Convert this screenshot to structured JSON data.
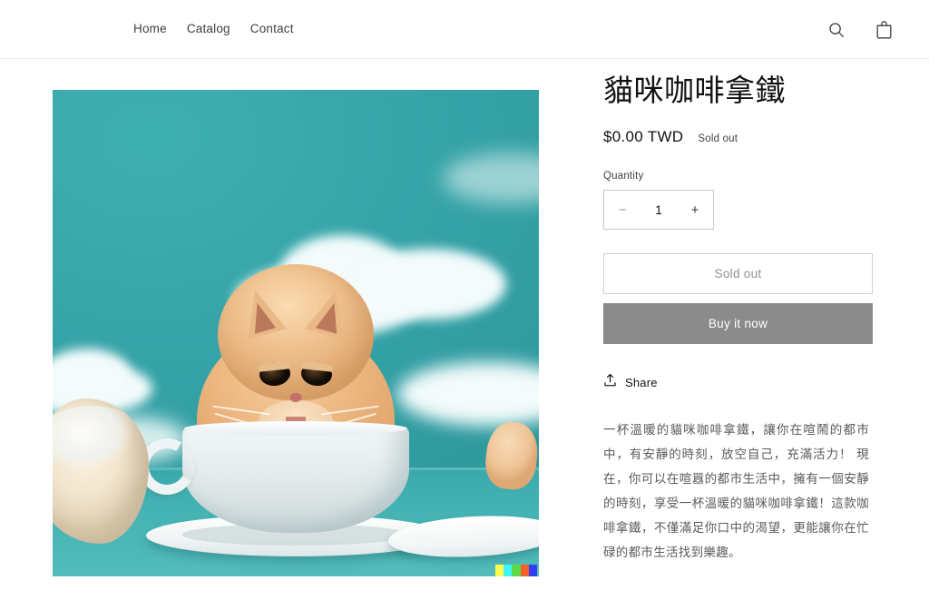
{
  "header": {
    "nav": [
      {
        "label": "Home"
      },
      {
        "label": "Catalog"
      },
      {
        "label": "Contact"
      }
    ],
    "search_icon": "search-icon",
    "cart_icon": "shopping-bag-icon"
  },
  "product": {
    "title": "貓咪咖啡拿鐵",
    "price": "$0.00 TWD",
    "availability_badge": "Sold out",
    "quantity": {
      "label": "Quantity",
      "decrease": "−",
      "value": "1",
      "increase": "+"
    },
    "add_to_cart_label": "Sold out",
    "buy_now_label": "Buy it now",
    "share_label": "Share",
    "share_icon": "share-upload-icon",
    "description": "一杯溫暖的貓咪咖啡拿鐵，讓你在喧鬧的都市中，有安靜的時刻，放空自己，充滿活力！ 現在，你可以在喧囂的都市生活中，擁有一個安靜的時刻，享受一杯溫暖的貓咪咖啡拿鐵！這款咖啡拿鐵，不僅滿足你口中的渴望，更能讓你在忙碌的都市生活找到樂趣。",
    "image": {
      "alt": "貓咪咖啡拿鐵 product photo",
      "sky_color": "#36a5a8",
      "cat_color": "#eec396",
      "cup_color": "#eef4f4",
      "watermark_swatches": [
        "#fffc4e",
        "#3ef5f5",
        "#5ed94b",
        "#f5602a",
        "#2d3ff0"
      ]
    }
  }
}
